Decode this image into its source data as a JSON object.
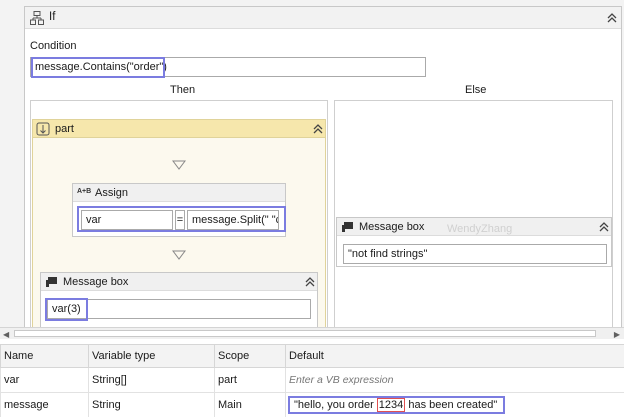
{
  "if_activity": {
    "title": "If",
    "condition_label": "Condition",
    "condition_value": "message.Contains(\"order\")",
    "then_label": "Then",
    "else_label": "Else"
  },
  "sequence": {
    "title": "part"
  },
  "assign": {
    "title": "Assign",
    "icon_text": "A+B",
    "to_value": "var",
    "equals": "=",
    "value": "message.Split(\" \"c)"
  },
  "then_message_box": {
    "title": "Message box",
    "text": "var(3)"
  },
  "else_message_box": {
    "title": "Message box",
    "text": "\"not find strings\""
  },
  "watermark": "WendyZhang",
  "variables": {
    "headers": [
      "Name",
      "Variable type",
      "Scope",
      "Default"
    ],
    "rows": [
      {
        "name": "var",
        "type": "String[]",
        "scope": "part",
        "default": "Enter a VB expression"
      },
      {
        "name": "message",
        "type": "String",
        "scope": "Main",
        "default_before": "\"hello, you order ",
        "default_highlight": "1234",
        "default_after": " has been created\""
      }
    ]
  },
  "colors": {
    "highlight_blue": "#7b7ce0",
    "highlight_red": "#e05050",
    "sequence_header": "#f6e7ac"
  }
}
